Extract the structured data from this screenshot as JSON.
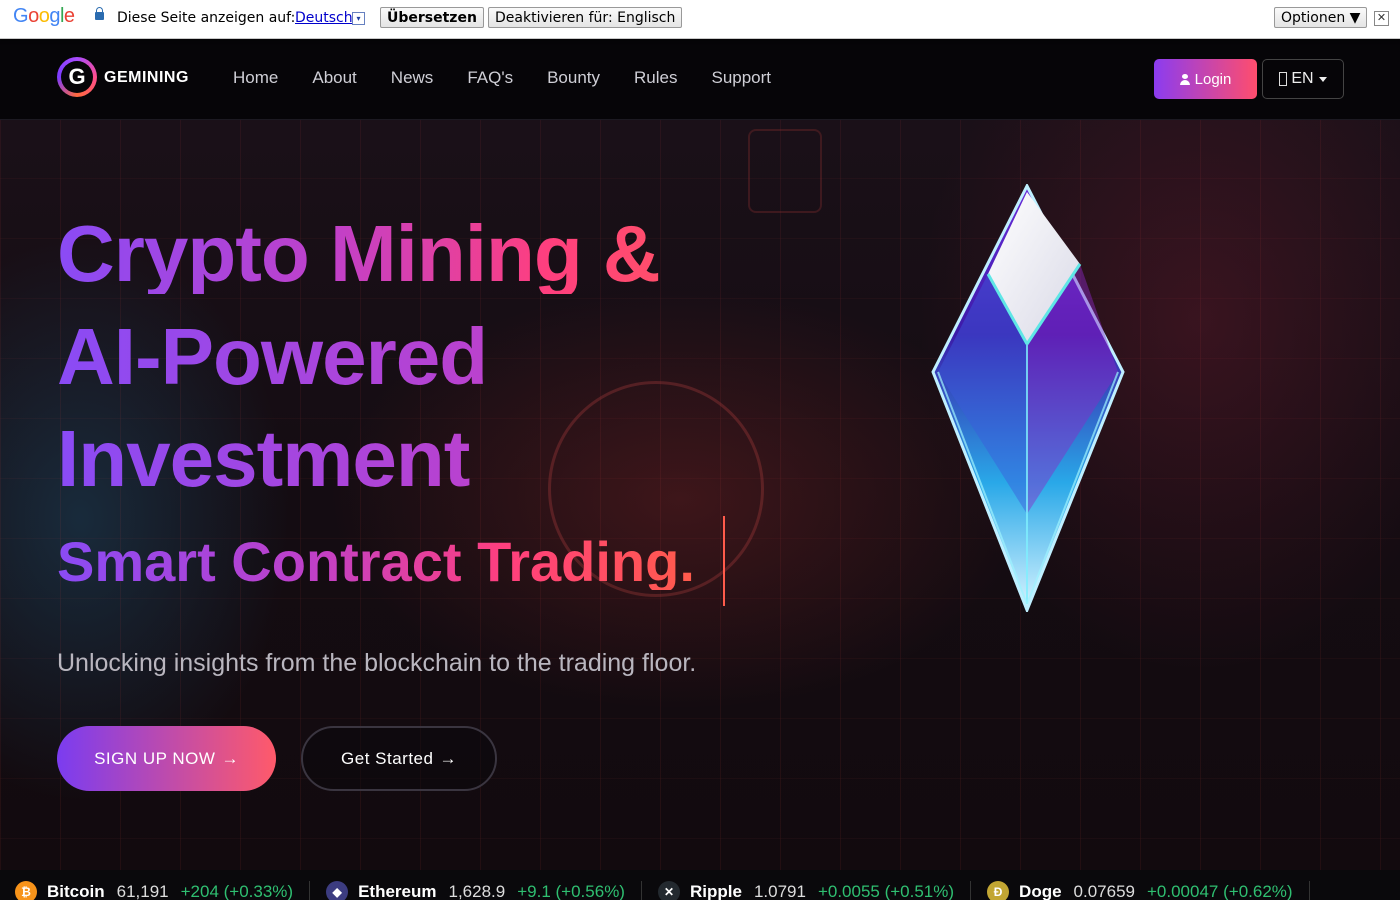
{
  "translate_bar": {
    "logo": "Google",
    "prompt": "Diese Seite anzeigen auf:",
    "language": "Deutsch",
    "language_dropdown": "▾",
    "translate_button": "Übersetzen",
    "deactivate_button": "Deaktivieren für: Englisch",
    "options_button": "Optionen ▼",
    "close": "✕"
  },
  "nav": {
    "logo_letter": "G",
    "brand": "GEMINING",
    "links": [
      "Home",
      "About",
      "News",
      "FAQ's",
      "Bounty",
      "Rules",
      "Support"
    ],
    "login_label": "Login",
    "lang_label": "EN"
  },
  "hero": {
    "title_line1": "Crypto Mining &",
    "title_line2": "AI-Powered",
    "title_line3": "Investment",
    "typed_text": "Smart Contract Trading.",
    "subtitle": "Unlocking insights from the blockchain to the trading floor.",
    "signup_label": "SIGN UP NOW",
    "get_started_label": "Get Started",
    "arrow": "→"
  },
  "ticker": [
    {
      "name": "Bitcoin",
      "price": "61,191",
      "change": "+204 (+0.33%)",
      "icon": "bitcoin-icon",
      "color": "#f7931a",
      "glyph": "₿"
    },
    {
      "name": "Ethereum",
      "price": "1,628.9",
      "change": "+9.1 (+0.56%)",
      "icon": "ethereum-icon",
      "color": "#3c3c80",
      "glyph": "◆"
    },
    {
      "name": "Ripple",
      "price": "1.0791",
      "change": "+0.0055 (+0.51%)",
      "icon": "ripple-icon",
      "color": "#23292f",
      "glyph": "✕"
    },
    {
      "name": "Doge",
      "price": "0.07659",
      "change": "+0.00047 (+0.62%)",
      "icon": "doge-icon",
      "color": "#c2a633",
      "glyph": "Ð"
    }
  ],
  "colors": {
    "accent_purple": "#8b3cf0",
    "accent_pink": "#ff4d6d",
    "positive": "#2fbf71"
  }
}
